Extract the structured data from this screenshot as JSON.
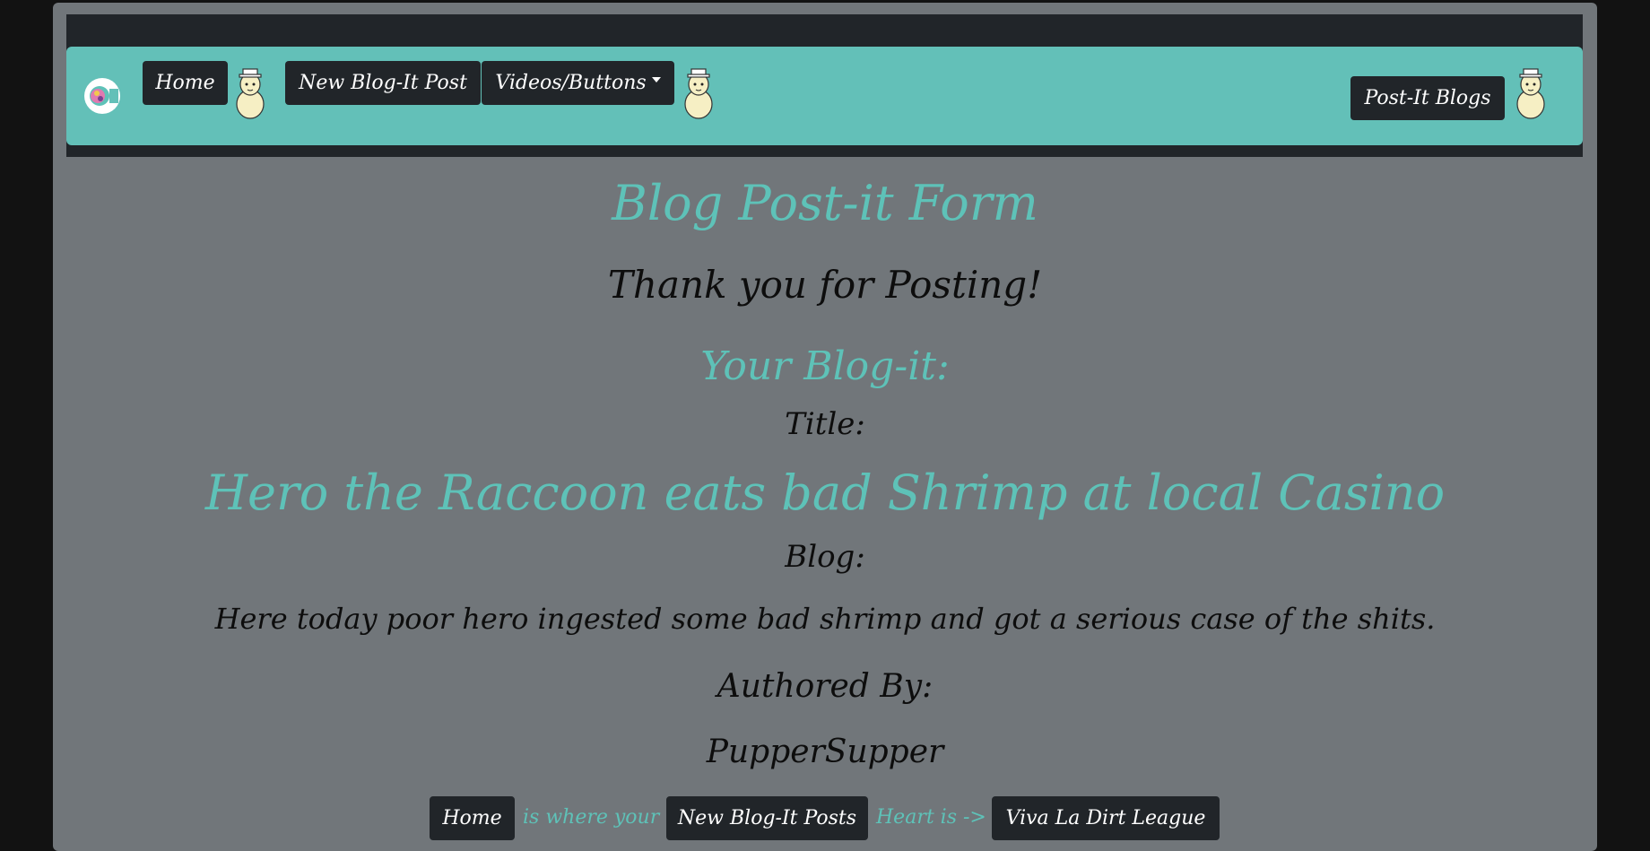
{
  "nav": {
    "home": "Home",
    "new_post": "New Blog-It Post",
    "videos": "Videos/Buttons",
    "post_it_blogs": "Post-It Blogs"
  },
  "main": {
    "heading": "Blog Post-it Form",
    "thanks": "Thank you for Posting!",
    "your_blog": "Your Blog-it:",
    "title_label": "Title:",
    "title_value": "Hero the Raccoon eats bad Shrimp at local Casino",
    "blog_label": "Blog:",
    "blog_value": "Here today poor hero ingested some bad shrimp and got a serious case of the shits.",
    "authored_label": "Authored By:",
    "author": "PupperSupper"
  },
  "footer": {
    "home": "Home",
    "text1": "is where your",
    "new_posts": "New Blog-It Posts",
    "text2": "Heart is ->",
    "vldl": "Viva La Dirt League"
  },
  "colors": {
    "teal": "#63c0b8",
    "dark": "#212529",
    "panel": "#71767a"
  },
  "icons": [
    "logo-icon",
    "llama-icon",
    "caret-down-icon"
  ]
}
